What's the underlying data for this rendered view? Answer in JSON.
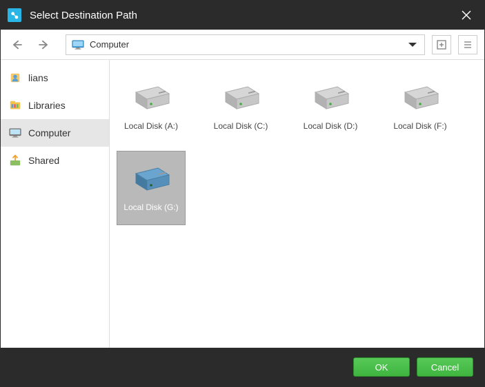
{
  "title": "Select Destination Path",
  "path": {
    "label": "Computer"
  },
  "sidebar": {
    "items": [
      {
        "label": "lians",
        "icon": "user",
        "selected": false
      },
      {
        "label": "Libraries",
        "icon": "libraries",
        "selected": false
      },
      {
        "label": "Computer",
        "icon": "monitor",
        "selected": true
      },
      {
        "label": "Shared",
        "icon": "shared",
        "selected": false
      }
    ]
  },
  "drives": [
    {
      "label": "Local Disk (A:)",
      "selected": false
    },
    {
      "label": "Local Disk (C:)",
      "selected": false
    },
    {
      "label": "Local Disk (D:)",
      "selected": false
    },
    {
      "label": "Local Disk (F:)",
      "selected": false
    },
    {
      "label": "Local Disk (G:)",
      "selected": true
    }
  ],
  "buttons": {
    "ok": "OK",
    "cancel": "Cancel"
  }
}
